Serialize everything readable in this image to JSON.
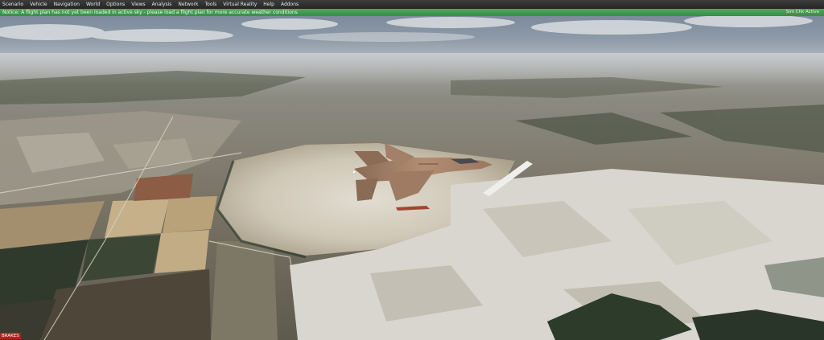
{
  "menu": {
    "items": [
      {
        "label": "Scenario"
      },
      {
        "label": "Vehicle"
      },
      {
        "label": "Navigation"
      },
      {
        "label": "World"
      },
      {
        "label": "Options"
      },
      {
        "label": "Views"
      },
      {
        "label": "Analysis"
      },
      {
        "label": "Network"
      },
      {
        "label": "Tools"
      },
      {
        "label": "Virtual Reality"
      },
      {
        "label": "Help"
      },
      {
        "label": "Addons"
      }
    ]
  },
  "notice": {
    "message": "Notice: A flight plan has not yet been loaded in active sky - please load a flight plan for more accurate weather conditions",
    "link": "Sim Chk Active"
  },
  "status": {
    "badge": "BRAKES"
  },
  "colors": {
    "menu_bg": "#2f2f2f",
    "notice_bg": "#45995a",
    "badge_bg": "#b0221e"
  }
}
